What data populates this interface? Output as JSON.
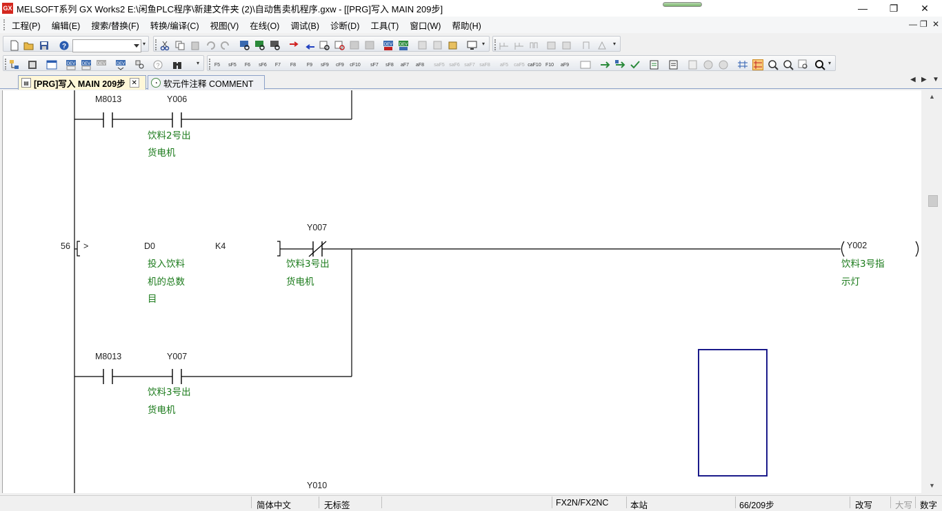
{
  "window": {
    "icon_label": "GX",
    "title": "MELSOFT系列 GX Works2 E:\\闲鱼PLC程序\\新建文件夹 (2)\\自动售卖机程序.gxw - [[PRG]写入 MAIN 209步]",
    "controls": [
      "—",
      "❐",
      "✕"
    ]
  },
  "menu": {
    "items": [
      "工程(P)",
      "编辑(E)",
      "搜索/替换(F)",
      "转换/编译(C)",
      "视图(V)",
      "在线(O)",
      "调试(B)",
      "诊断(D)",
      "工具(T)",
      "窗口(W)",
      "帮助(H)"
    ],
    "mdi_controls": [
      "—",
      "❐",
      "✕"
    ]
  },
  "toolbar2_keys": [
    "F5",
    "sF5",
    "F6",
    "sF6",
    "F7",
    "F8",
    "F9",
    "sF9",
    "cF9",
    "cF10",
    "sF7",
    "sF8",
    "aF7",
    "aF8",
    "saF5",
    "saF6",
    "saF7",
    "saF8",
    "aF5",
    "caF5",
    "caF10",
    "F10",
    "aF9"
  ],
  "tabs": [
    {
      "label": "[PRG]写入 MAIN 209步",
      "close": "✕"
    },
    {
      "label": "软元件注释 COMMENT"
    }
  ],
  "tab_nav": [
    "◀",
    "▶",
    "▼"
  ],
  "ladder": {
    "rung1": {
      "contact1": "M8013",
      "contact2": "Y006",
      "comment_line1": "饮料2号出",
      "comment_line2": "货电机"
    },
    "rung2": {
      "step": "56",
      "compare_op": ">",
      "operand1": "D0",
      "operand2": "K4",
      "op1_comment": [
        "投入饮料",
        "机的总数",
        "目"
      ],
      "nc_contact": "Y007",
      "nc_comment": [
        "饮料3号出",
        "货电机"
      ],
      "coil": "Y002",
      "coil_comment": [
        "饮料3号指",
        "示灯"
      ],
      "contact1": "M8013",
      "contact2": "Y007",
      "contact2_comment": [
        "饮料3号出",
        "货电机"
      ]
    },
    "rung3": {
      "contact": "Y010"
    }
  },
  "statusbar": {
    "language": "简体中文",
    "label": "无标签",
    "plc": "FX2N/FX2NC",
    "station": "本站",
    "steps": "66/209步",
    "mode": "改写",
    "caps": "大写",
    "num": "数字"
  }
}
